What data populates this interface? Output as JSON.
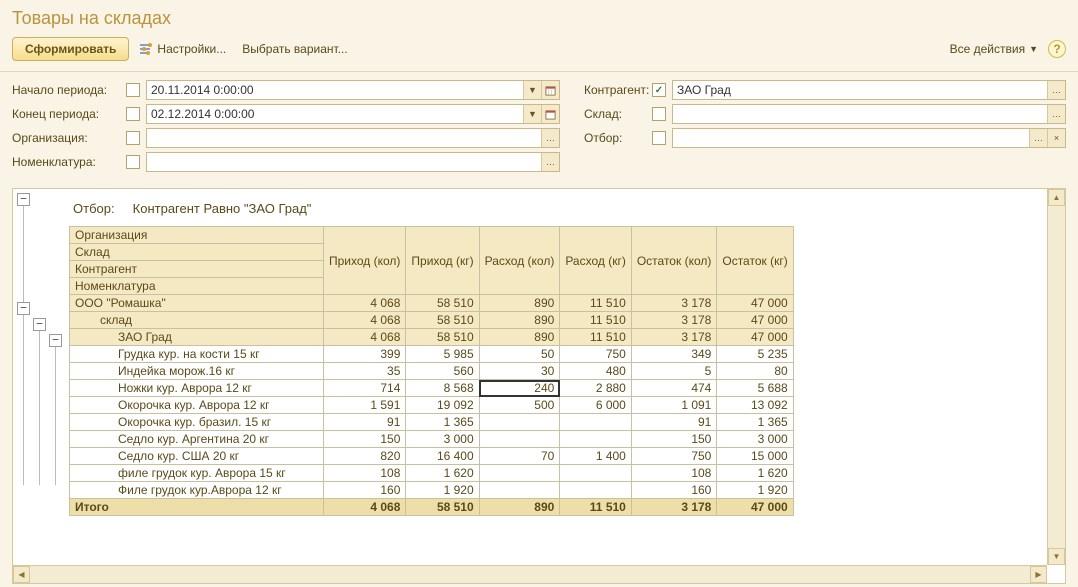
{
  "title": "Товары на складах",
  "toolbar": {
    "generate": "Сформировать",
    "settings": "Настройки...",
    "choose_variant": "Выбрать вариант...",
    "all_actions": "Все действия"
  },
  "filters": {
    "period_start_label": "Начало периода:",
    "period_start_value": "20.11.2014 0:00:00",
    "period_end_label": "Конец периода:",
    "period_end_value": "02.12.2014 0:00:00",
    "org_label": "Организация:",
    "org_value": "",
    "nom_label": "Номенклатура:",
    "nom_value": "",
    "contr_label": "Контрагент:",
    "contr_value": "ЗАО Град",
    "contr_checked": "✓",
    "sklad_label": "Склад:",
    "sklad_value": "",
    "otbor_label": "Отбор:",
    "otbor_value": ""
  },
  "report": {
    "filter_caption_label": "Отбор:",
    "filter_caption_value": "Контрагент Равно \"ЗАО Град\"",
    "headers": {
      "group": [
        "Организация",
        "Склад",
        "Контрагент",
        "Номенклатура"
      ],
      "cols": [
        "Приход (кол)",
        "Приход (кг)",
        "Расход (кол)",
        "Расход (кг)",
        "Остаток (кол)",
        "Остаток (кг)"
      ]
    },
    "rows": [
      {
        "lvl": 0,
        "grp": true,
        "name": "ООО \"Ромашка\"",
        "v": [
          "4 068",
          "58 510",
          "890",
          "11 510",
          "3 178",
          "47 000"
        ]
      },
      {
        "lvl": 1,
        "grp": true,
        "name": "склад",
        "v": [
          "4 068",
          "58 510",
          "890",
          "11 510",
          "3 178",
          "47 000"
        ]
      },
      {
        "lvl": 2,
        "grp": true,
        "name": "ЗАО Град",
        "v": [
          "4 068",
          "58 510",
          "890",
          "11 510",
          "3 178",
          "47 000"
        ]
      },
      {
        "lvl": 3,
        "name": "Грудка кур. на кости 15 кг",
        "v": [
          "399",
          "5 985",
          "50",
          "750",
          "349",
          "5 235"
        ]
      },
      {
        "lvl": 3,
        "name": "Индейка морож.16 кг",
        "v": [
          "35",
          "560",
          "30",
          "480",
          "5",
          "80"
        ]
      },
      {
        "lvl": 3,
        "name": "Ножки кур. Аврора 12 кг",
        "v": [
          "714",
          "8 568",
          "240",
          "2 880",
          "474",
          "5 688"
        ],
        "sel": 2
      },
      {
        "lvl": 3,
        "name": "Окорочка кур. Аврора 12 кг",
        "v": [
          "1 591",
          "19 092",
          "500",
          "6 000",
          "1 091",
          "13 092"
        ]
      },
      {
        "lvl": 3,
        "name": "Окорочка кур. бразил. 15 кг",
        "v": [
          "91",
          "1 365",
          "",
          "",
          "91",
          "1 365"
        ]
      },
      {
        "lvl": 3,
        "name": "Седло кур. Аргентина 20 кг",
        "v": [
          "150",
          "3 000",
          "",
          "",
          "150",
          "3 000"
        ]
      },
      {
        "lvl": 3,
        "name": "Седло кур. США 20 кг",
        "v": [
          "820",
          "16 400",
          "70",
          "1 400",
          "750",
          "15 000"
        ]
      },
      {
        "lvl": 3,
        "name": "филе грудок кур. Аврора 15 кг",
        "v": [
          "108",
          "1 620",
          "",
          "",
          "108",
          "1 620"
        ]
      },
      {
        "lvl": 3,
        "name": "Филе грудок кур.Аврора 12 кг",
        "v": [
          "160",
          "1 920",
          "",
          "",
          "160",
          "1 920"
        ]
      }
    ],
    "total": {
      "name": "Итого",
      "v": [
        "4 068",
        "58 510",
        "890",
        "11 510",
        "3 178",
        "47 000"
      ]
    }
  },
  "chart_data": {
    "type": "table",
    "title": "Товары на складах — Контрагент Равно \"ЗАО Град\"",
    "columns": [
      "Номенклатура",
      "Приход (кол)",
      "Приход (кг)",
      "Расход (кол)",
      "Расход (кг)",
      "Остаток (кол)",
      "Остаток (кг)"
    ],
    "rows": [
      [
        "Грудка кур. на кости 15 кг",
        399,
        5985,
        50,
        750,
        349,
        5235
      ],
      [
        "Индейка морож.16 кг",
        35,
        560,
        30,
        480,
        5,
        80
      ],
      [
        "Ножки кур. Аврора 12 кг",
        714,
        8568,
        240,
        2880,
        474,
        5688
      ],
      [
        "Окорочка кур. Аврора 12 кг",
        1591,
        19092,
        500,
        6000,
        1091,
        13092
      ],
      [
        "Окорочка кур. бразил. 15 кг",
        91,
        1365,
        null,
        null,
        91,
        1365
      ],
      [
        "Седло кур. Аргентина 20 кг",
        150,
        3000,
        null,
        null,
        150,
        3000
      ],
      [
        "Седло кур. США 20 кг",
        820,
        16400,
        70,
        1400,
        750,
        15000
      ],
      [
        "филе грудок кур. Аврора 15 кг",
        108,
        1620,
        null,
        null,
        108,
        1620
      ],
      [
        "Филе грудок кур.Аврора 12 кг",
        160,
        1920,
        null,
        null,
        160,
        1920
      ]
    ],
    "totals": [
      "Итого",
      4068,
      58510,
      890,
      11510,
      3178,
      47000
    ]
  }
}
